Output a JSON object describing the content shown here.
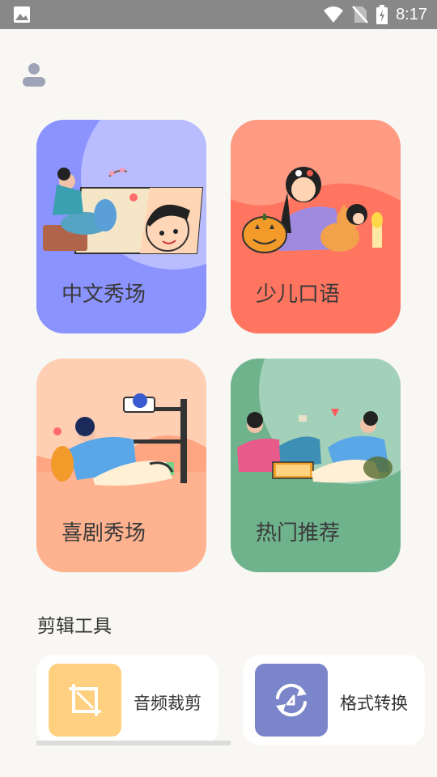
{
  "status_bar": {
    "time": "8:17"
  },
  "cards": [
    {
      "label": "中文秀场",
      "bg": "#8b93ff"
    },
    {
      "label": "少儿口语",
      "bg": "#ff7560"
    },
    {
      "label": "喜剧秀场",
      "bg": "#ffb28f"
    },
    {
      "label": "热门推荐",
      "bg": "#6fb38d"
    }
  ],
  "tools": {
    "section_title": "剪辑工具",
    "items": [
      {
        "label": "音频裁剪",
        "icon": "crop-icon",
        "color": "#ffd07f"
      },
      {
        "label": "格式转换",
        "icon": "convert-icon",
        "color": "#7b85c9"
      }
    ]
  }
}
